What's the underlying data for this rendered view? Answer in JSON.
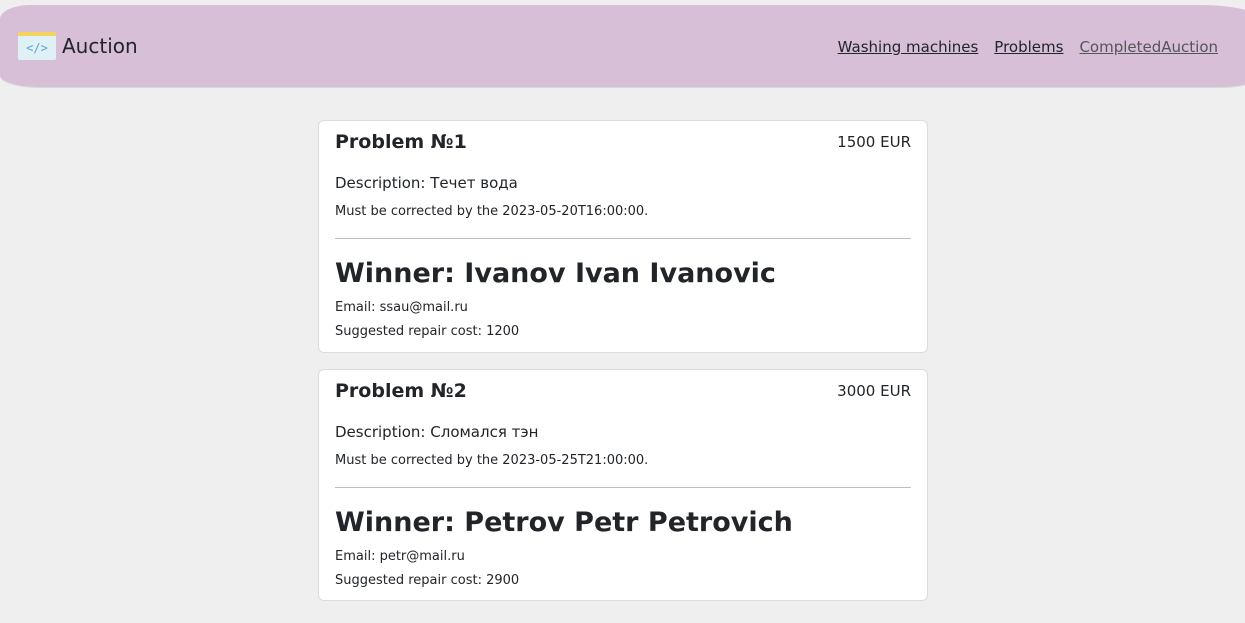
{
  "header": {
    "brand": "Auction",
    "nav": [
      {
        "label": "Washing machines"
      },
      {
        "label": "Problems"
      },
      {
        "label": "CompletedAuction"
      }
    ]
  },
  "problems": [
    {
      "title": "Problem №1",
      "price": "1500 EUR",
      "description": "Description: Течет вода",
      "deadline": "Must be corrected by the 2023-05-20T16:00:00.",
      "winner": "Winner: Ivanov Ivan Ivanovic",
      "email": "Email: ssau@mail.ru",
      "cost": "Suggested repair cost: 1200"
    },
    {
      "title": "Problem №2",
      "price": "3000 EUR",
      "description": "Description: Сломался тэн",
      "deadline": "Must be corrected by the 2023-05-25T21:00:00.",
      "winner": "Winner: Petrov Petr Petrovich",
      "email": "Email: petr@mail.ru",
      "cost": "Suggested repair cost: 2900"
    }
  ]
}
